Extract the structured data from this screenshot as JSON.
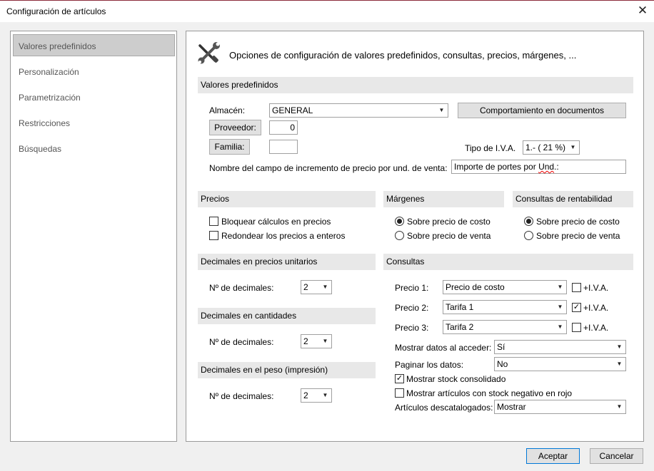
{
  "window": {
    "title": "Configuración de artículos",
    "close_glyph": "✕"
  },
  "sidebar": {
    "items": [
      {
        "label": "Valores predefinidos",
        "selected": true
      },
      {
        "label": "Personalización",
        "selected": false
      },
      {
        "label": "Parametrización",
        "selected": false
      },
      {
        "label": "Restricciones",
        "selected": false
      },
      {
        "label": "Búsquedas",
        "selected": false
      }
    ]
  },
  "header": {
    "icon": "tools-icon",
    "text": "Opciones de configuración de valores predefinidos, consultas, precios, márgenes, ..."
  },
  "predefinidos": {
    "section_title": "Valores predefinidos",
    "almacen_label": "Almacén:",
    "almacen_value": "GENERAL",
    "comportamiento_button": "Comportamiento en documentos",
    "proveedor_button": "Proveedor:",
    "proveedor_value": "0",
    "familia_button": "Familia:",
    "familia_value": "",
    "tipo_iva_label": "Tipo de I.V.A.",
    "tipo_iva_value": "1.- ( 21 %)",
    "nombre_campo_label": "Nombre del campo de incremento de precio por und. de venta:",
    "nombre_campo_value_main": "Importe de portes por ",
    "nombre_campo_value_flagged": "Und",
    "nombre_campo_value_end": ".:"
  },
  "precios": {
    "section_title": "Precios",
    "bloquear_label": "Bloquear cálculos en precios",
    "bloquear_checked": false,
    "redondear_label": "Redondear los precios a enteros",
    "redondear_checked": false
  },
  "margenes": {
    "section_title": "Márgenes",
    "option_costo": "Sobre precio de costo",
    "option_venta": "Sobre precio de venta",
    "selected": "costo"
  },
  "rentabilidad": {
    "section_title": "Consultas de rentabilidad",
    "option_costo": "Sobre precio de costo",
    "option_venta": "Sobre precio de venta",
    "selected": "costo"
  },
  "decimales_precios": {
    "section_title": "Decimales en precios unitarios",
    "label": "Nº de decimales:",
    "value": "2"
  },
  "decimales_cantidades": {
    "section_title": "Decimales en cantidades",
    "label": "Nº de decimales:",
    "value": "2"
  },
  "decimales_peso": {
    "section_title": "Decimales en el peso (impresión)",
    "label": "Nº de decimales:",
    "value": "2"
  },
  "consultas": {
    "section_title": "Consultas",
    "precios": [
      {
        "label": "Precio 1:",
        "value": "Precio de costo",
        "iva_label": "+I.V.A.",
        "iva_checked": false
      },
      {
        "label": "Precio 2:",
        "value": "Tarifa 1",
        "iva_label": "+I.V.A.",
        "iva_checked": true
      },
      {
        "label": "Precio 3:",
        "value": "Tarifa 2",
        "iva_label": "+I.V.A.",
        "iva_checked": false
      }
    ],
    "mostrar_datos_label": "Mostrar datos al acceder:",
    "mostrar_datos_value": "Sí",
    "paginar_label": "Paginar los datos:",
    "paginar_value": "No",
    "stock_consolidado_label": "Mostrar stock consolidado",
    "stock_consolidado_checked": true,
    "stock_negativo_label": "Mostrar artículos con stock negativo en rojo",
    "stock_negativo_checked": false,
    "descatalogados_label": "Artículos descatalogados:",
    "descatalogados_value": "Mostrar"
  },
  "footer": {
    "aceptar": "Aceptar",
    "cancelar": "Cancelar"
  },
  "glyphs": {
    "arrow_down": "▼",
    "check": "✓"
  }
}
